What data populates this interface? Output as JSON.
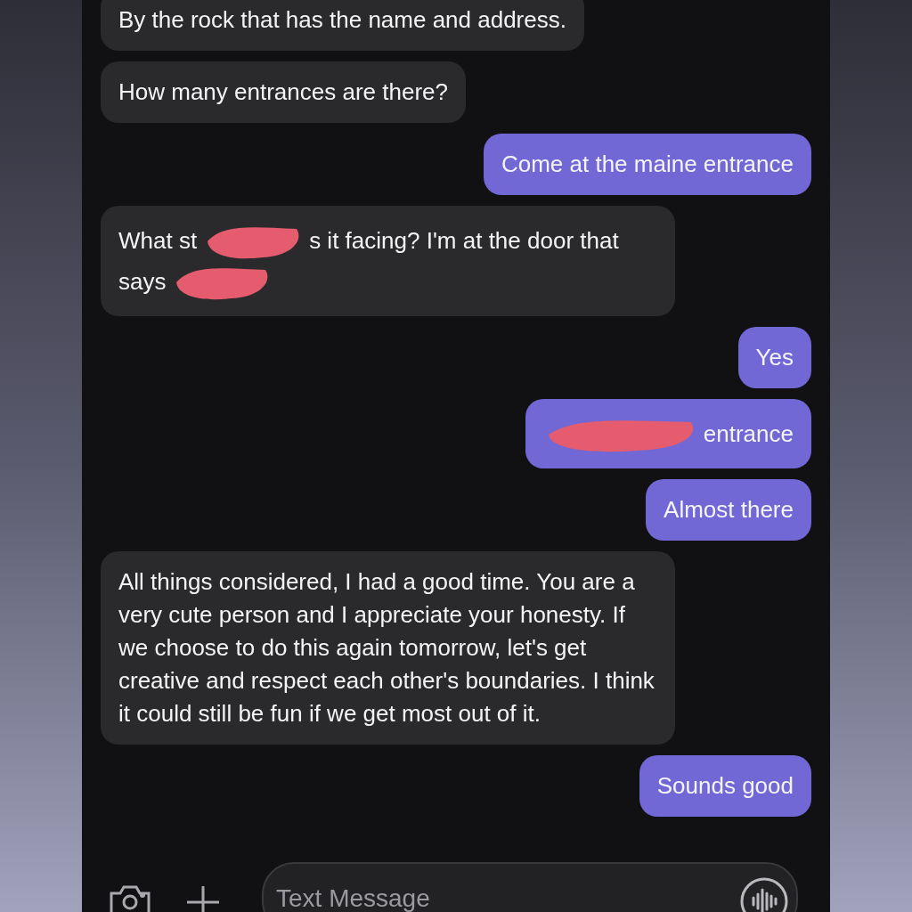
{
  "messages": [
    {
      "kind": "received",
      "parts": [
        {
          "kind": "text",
          "text": "By the rock that has the name and address."
        }
      ]
    },
    {
      "kind": "received",
      "parts": [
        {
          "kind": "text",
          "text": "How many entrances are there?"
        }
      ]
    },
    {
      "kind": "sent",
      "parts": [
        {
          "kind": "text",
          "text": "Come at the maine entrance"
        }
      ]
    },
    {
      "kind": "received",
      "parts": [
        {
          "kind": "text",
          "text": "What st"
        },
        {
          "kind": "redaction"
        },
        {
          "kind": "text",
          "text": "s it facing? I'm at the door that"
        },
        {
          "kind": "text",
          "text": "says"
        },
        {
          "kind": "redaction"
        }
      ]
    },
    {
      "kind": "sent",
      "parts": [
        {
          "kind": "text",
          "text": "Yes"
        }
      ]
    },
    {
      "kind": "sent",
      "parts": [
        {
          "kind": "redaction"
        },
        {
          "kind": "text",
          "text": "entrance"
        }
      ]
    },
    {
      "kind": "sent",
      "parts": [
        {
          "kind": "text",
          "text": "Almost there"
        }
      ]
    },
    {
      "kind": "received",
      "parts": [
        {
          "kind": "text",
          "text": "All things considered, I had a good time. You are a very cute person and I appreciate your honesty. If we choose to do this again tomorrow, let's get creative and respect each other's boundaries. I think it could still be fun if we get most out of it."
        }
      ]
    },
    {
      "kind": "sent",
      "parts": [
        {
          "kind": "text",
          "text": "Sounds good"
        }
      ]
    }
  ],
  "composer": {
    "placeholder": "Text Message"
  }
}
